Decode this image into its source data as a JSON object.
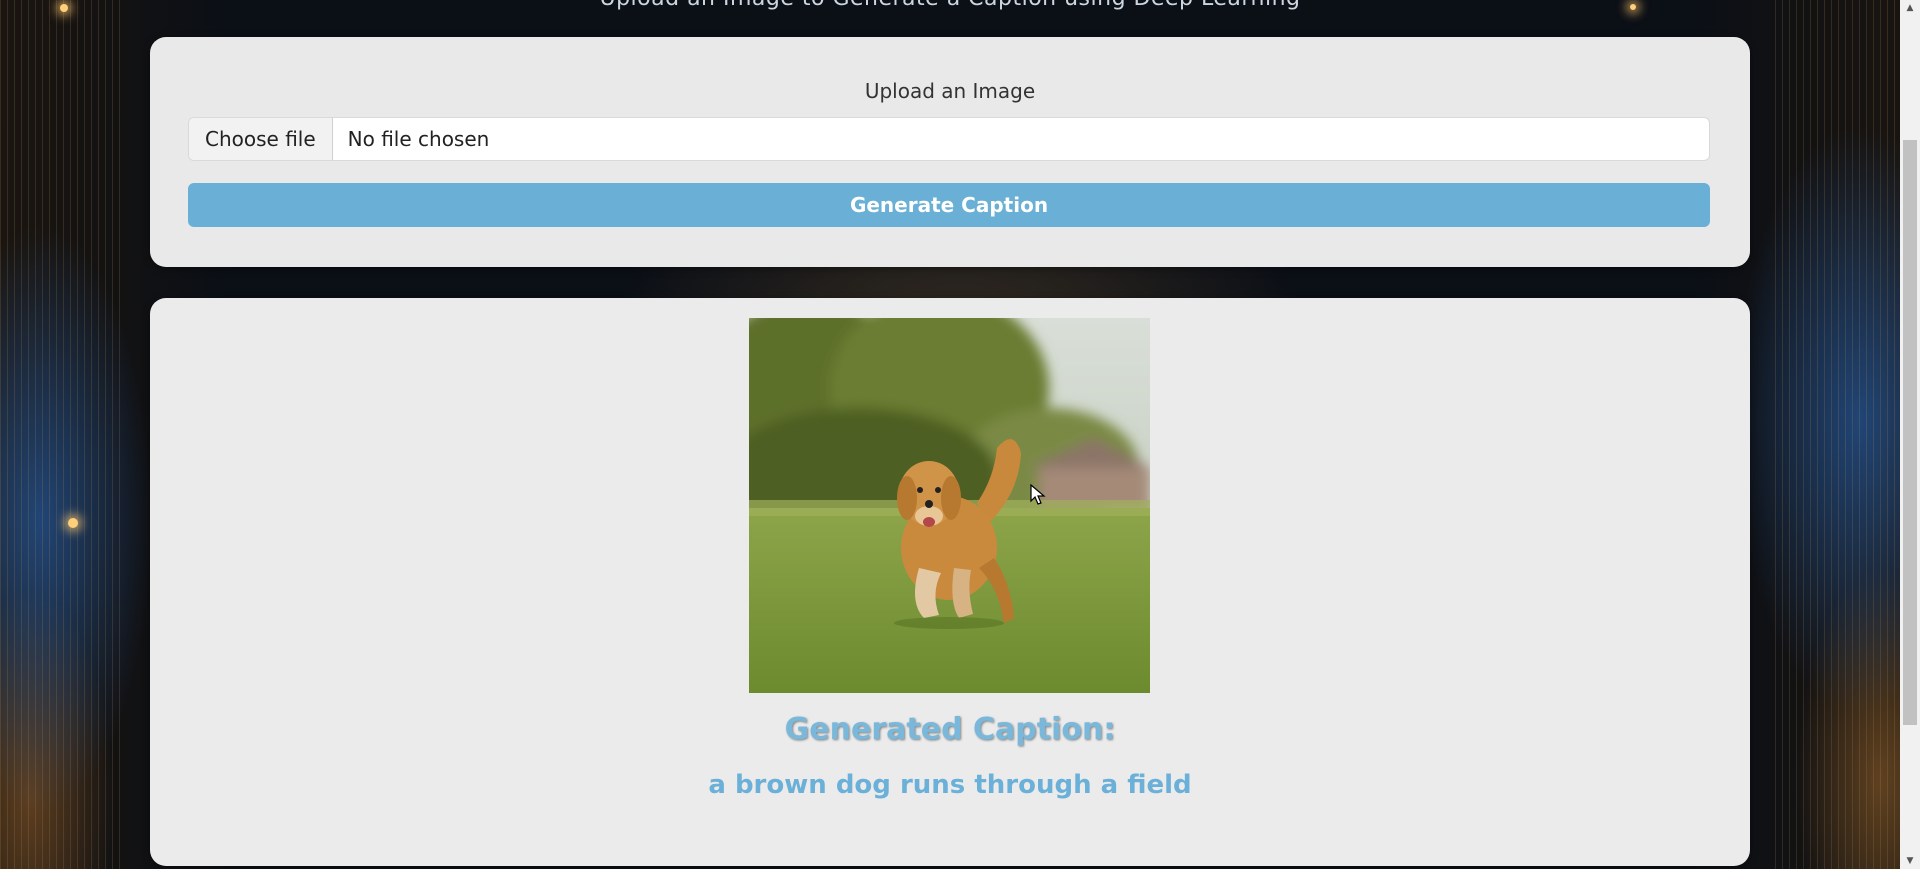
{
  "page": {
    "header_partial_text": "Upload an Image to Generate a Caption using Deep Learning"
  },
  "upload_form": {
    "label": "Upload an Image",
    "file_button_label": "Choose file",
    "file_status": "No file chosen",
    "submit_label": "Generate Caption"
  },
  "result": {
    "caption_heading": "Generated Caption:",
    "caption_text": "a brown dog runs through a field"
  },
  "colors": {
    "accent": "#6aafd5",
    "card_bg": "#e9e9e9",
    "caption_color": "#6ab0d8"
  }
}
